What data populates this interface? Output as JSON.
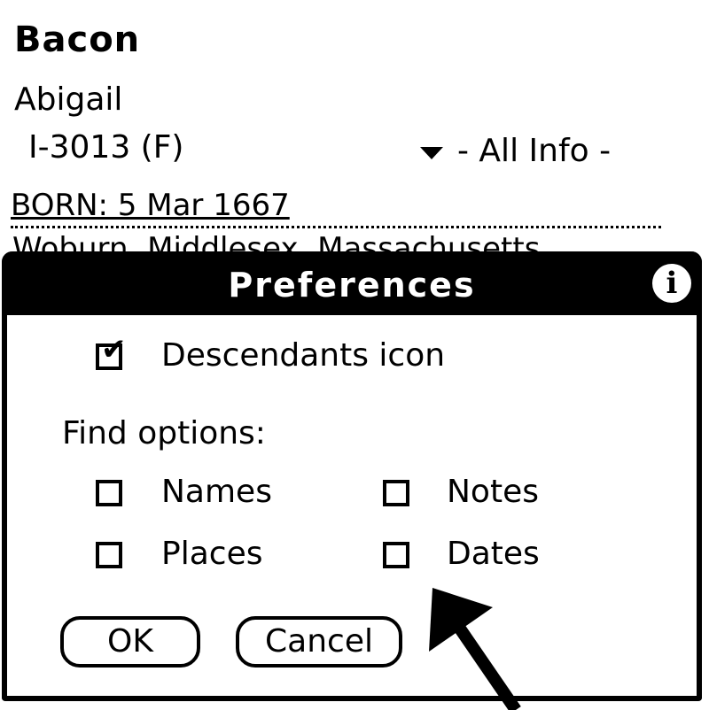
{
  "record": {
    "surname": "Bacon",
    "given_name": "Abigail",
    "id_sex": "I-3013 (F)",
    "view_selector": "- All Info -",
    "born": "BORN: 5 Mar 1667",
    "place_partial": "Woburn, Middlesex, Massachusetts"
  },
  "dialog": {
    "title": "Preferences",
    "info_glyph": "i",
    "descendants_icon": {
      "label": "Descendants icon",
      "checked": true
    },
    "find_options_label": "Find options:",
    "find_options": [
      {
        "label": "Names",
        "checked": false
      },
      {
        "label": "Notes",
        "checked": false
      },
      {
        "label": "Places",
        "checked": false
      },
      {
        "label": "Dates",
        "checked": false
      }
    ],
    "ok_label": "OK",
    "cancel_label": "Cancel"
  },
  "icons": {
    "dropdown": "triangle-down-icon",
    "info": "info-icon",
    "annotation": "arrow-annotation"
  }
}
